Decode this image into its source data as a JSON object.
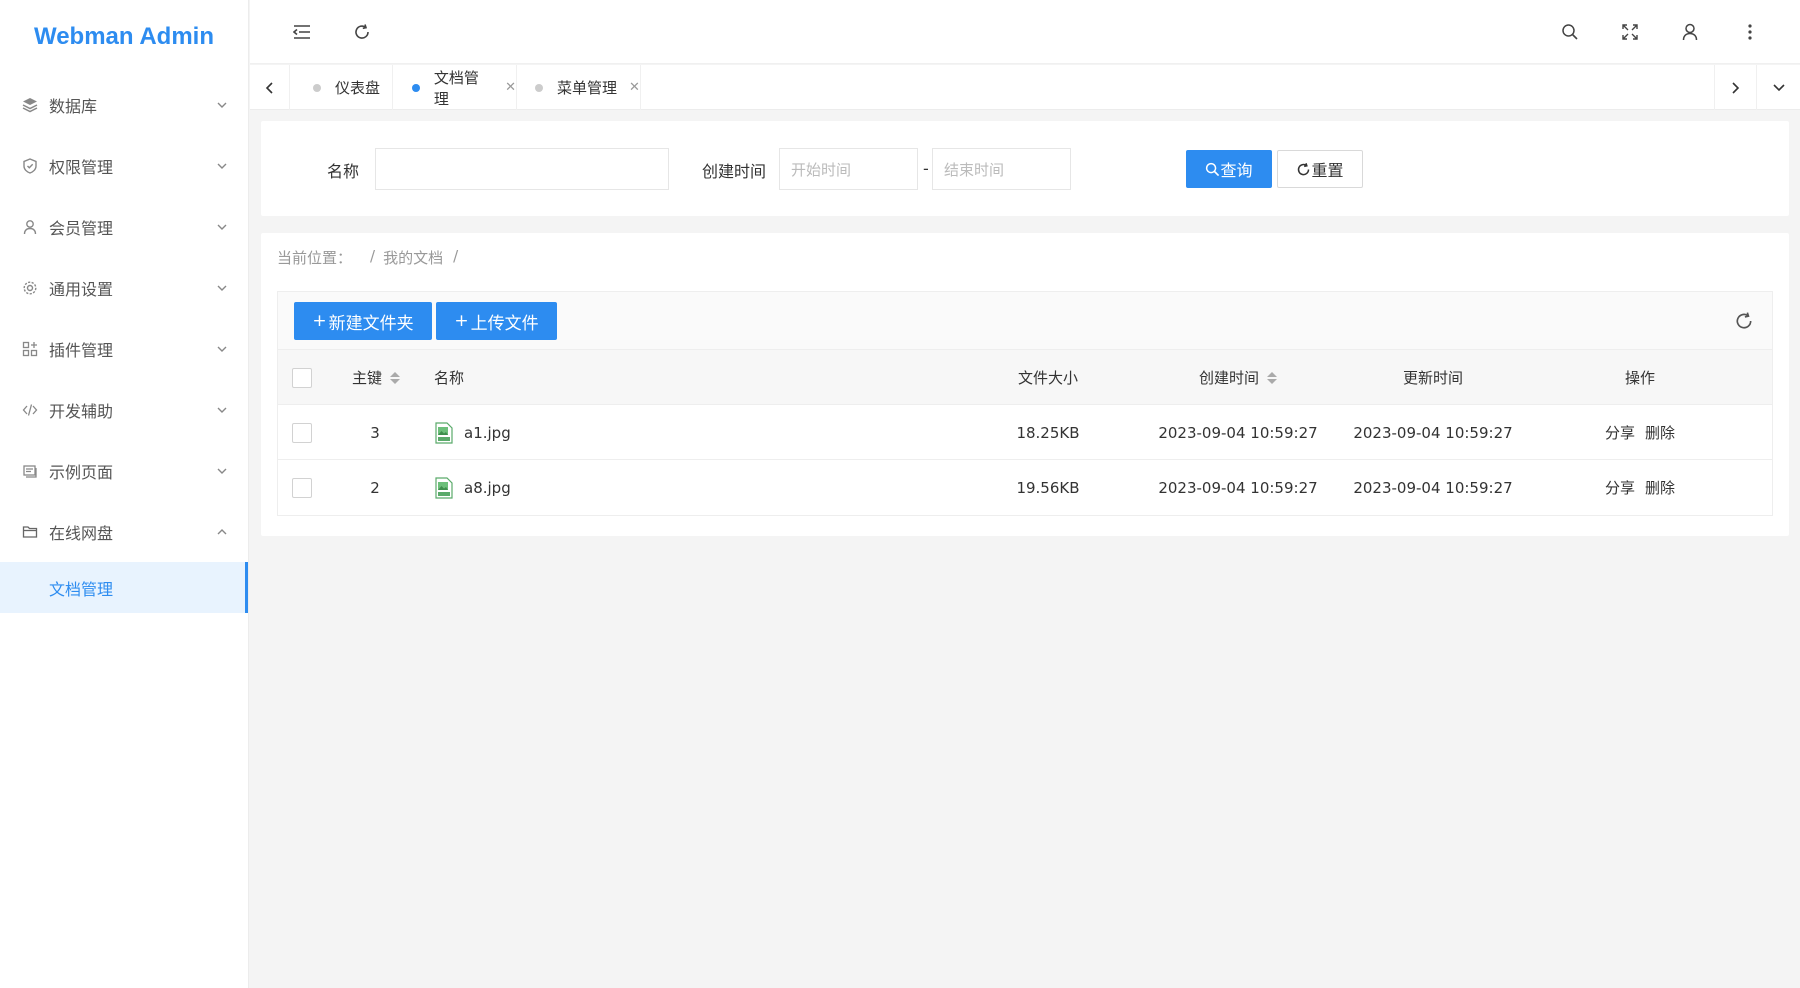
{
  "app": {
    "title": "Webman Admin"
  },
  "sidebar": {
    "items": [
      {
        "label": "数据库",
        "icon": "database-icon"
      },
      {
        "label": "权限管理",
        "icon": "shield-icon"
      },
      {
        "label": "会员管理",
        "icon": "user-icon"
      },
      {
        "label": "通用设置",
        "icon": "gear-icon"
      },
      {
        "label": "插件管理",
        "icon": "plugin-icon"
      },
      {
        "label": "开发辅助",
        "icon": "code-icon"
      },
      {
        "label": "示例页面",
        "icon": "page-icon"
      },
      {
        "label": "在线网盘",
        "icon": "folder-icon"
      }
    ],
    "submenu": {
      "label": "文档管理"
    }
  },
  "tabs": [
    {
      "label": "仪表盘",
      "active": false,
      "closable": false
    },
    {
      "label": "文档管理",
      "active": true,
      "closable": true
    },
    {
      "label": "菜单管理",
      "active": false,
      "closable": true
    }
  ],
  "search": {
    "name_label": "名称",
    "name_value": "",
    "time_label": "创建时间",
    "start_placeholder": "开始时间",
    "end_placeholder": "结束时间",
    "range_separator": "-",
    "query_button": "查询",
    "reset_button": "重置"
  },
  "breadcrumb": {
    "prefix": "当前位置：",
    "sep1": "/",
    "folder": "我的文档",
    "sep2": "/"
  },
  "toolbar": {
    "new_folder": "新建文件夹",
    "upload": "上传文件"
  },
  "table": {
    "headers": {
      "id": "主键",
      "name": "名称",
      "size": "文件大小",
      "created": "创建时间",
      "updated": "更新时间",
      "actions": "操作"
    },
    "rows": [
      {
        "id": "3",
        "name": "a1.jpg",
        "size": "18.25KB",
        "created": "2023-09-04 10:59:27",
        "updated": "2023-09-04 10:59:27",
        "share": "分享",
        "delete": "删除"
      },
      {
        "id": "2",
        "name": "a8.jpg",
        "size": "19.56KB",
        "created": "2023-09-04 10:59:27",
        "updated": "2023-09-04 10:59:27",
        "share": "分享",
        "delete": "删除"
      }
    ]
  },
  "colors": {
    "primary": "#2d8cf0",
    "active_bg": "#e8f3fe"
  }
}
